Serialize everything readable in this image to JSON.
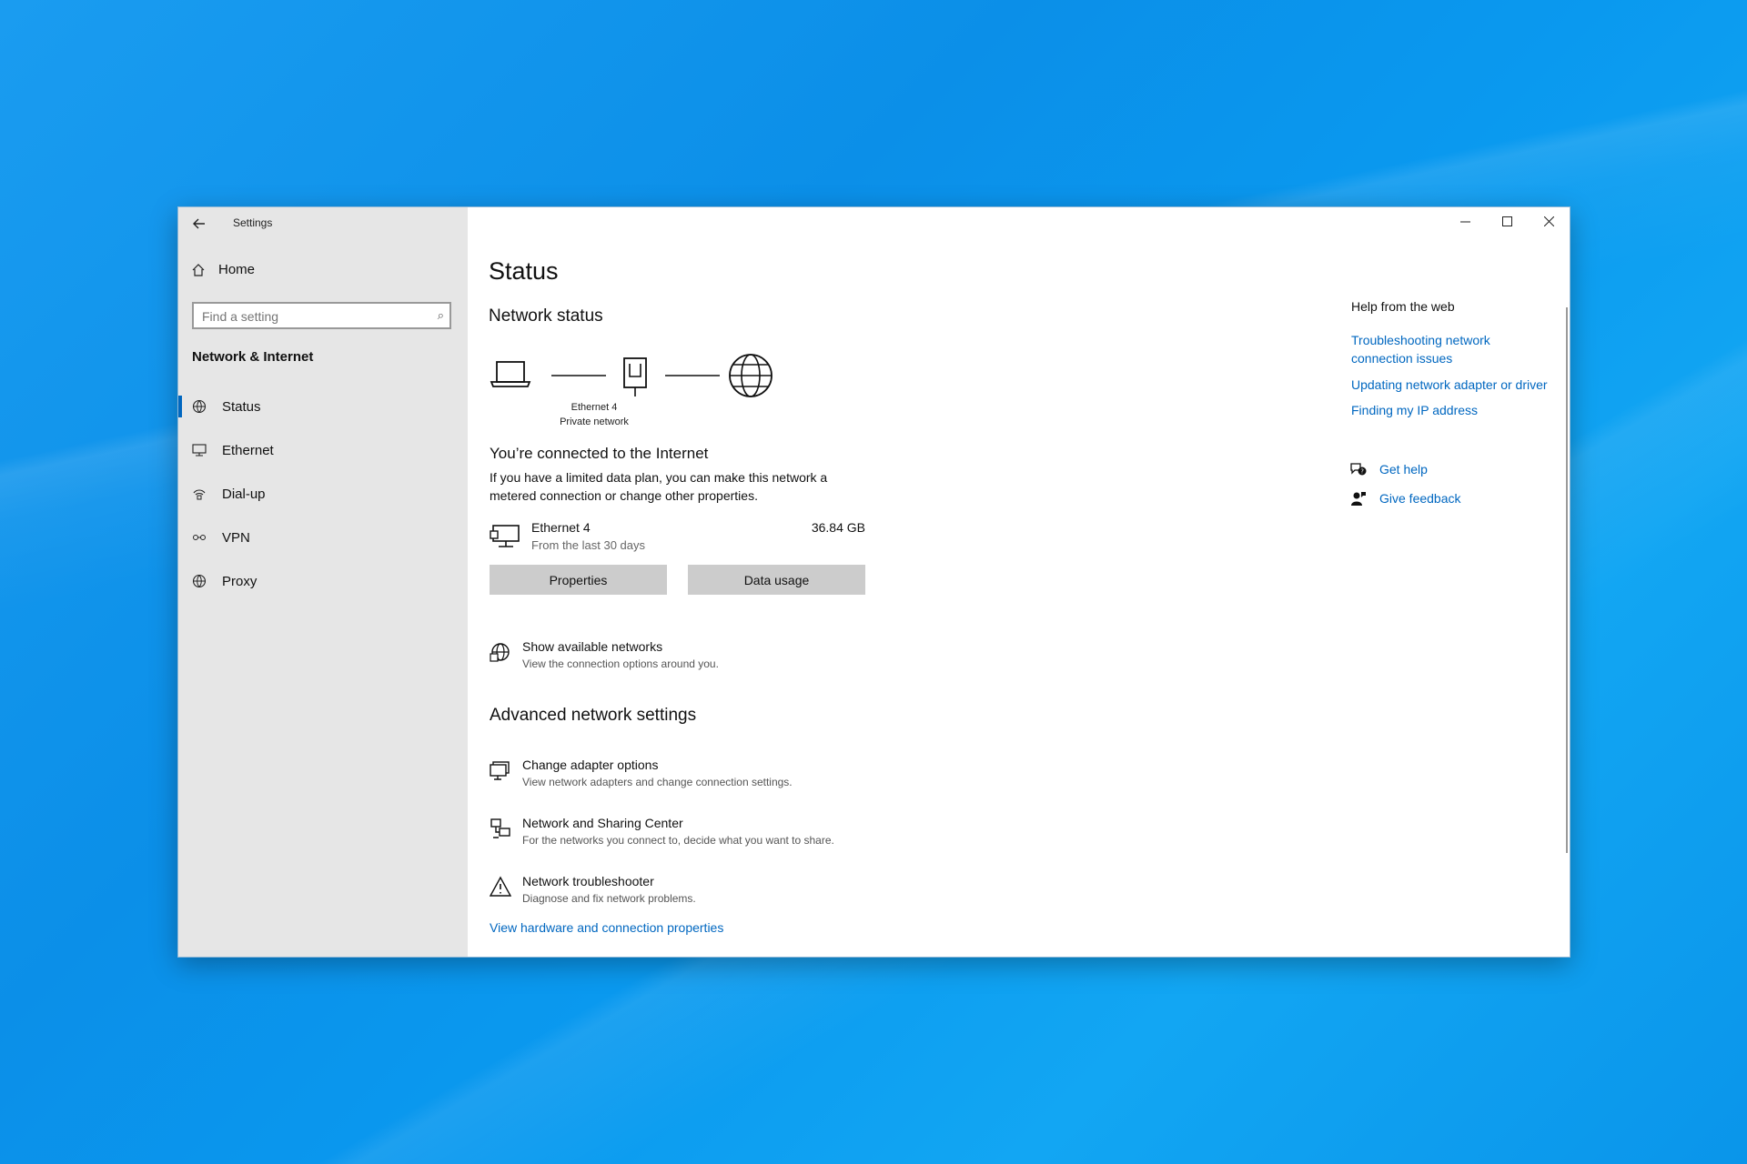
{
  "window": {
    "app_title": "Settings",
    "controls": {
      "minimize": "–",
      "maximize": "□",
      "close": "✕"
    }
  },
  "sidebar": {
    "home_label": "Home",
    "search_placeholder": "Find a setting",
    "section_title": "Network & Internet",
    "items": [
      {
        "label": "Status",
        "icon": "status-icon",
        "active": true
      },
      {
        "label": "Ethernet",
        "icon": "ethernet-icon",
        "active": false
      },
      {
        "label": "Dial-up",
        "icon": "dialup-icon",
        "active": false
      },
      {
        "label": "VPN",
        "icon": "vpn-icon",
        "active": false
      },
      {
        "label": "Proxy",
        "icon": "proxy-icon",
        "active": false
      }
    ]
  },
  "main": {
    "title": "Status",
    "network_status_heading": "Network status",
    "diagram": {
      "adapter_name": "Ethernet 4",
      "network_type": "Private network"
    },
    "connected_text": "You’re connected to the Internet",
    "description": "If you have a limited data plan, you can make this network a metered connection or change other properties.",
    "connection": {
      "name": "Ethernet 4",
      "sub": "From the last 30 days",
      "usage": "36.84 GB"
    },
    "buttons": {
      "properties": "Properties",
      "data_usage": "Data usage"
    },
    "show_networks": {
      "title": "Show available networks",
      "sub": "View the connection options around you."
    },
    "advanced_heading": "Advanced network settings",
    "advanced": [
      {
        "title": "Change adapter options",
        "sub": "View network adapters and change connection settings."
      },
      {
        "title": "Network and Sharing Center",
        "sub": "For the networks you connect to, decide what you want to share."
      },
      {
        "title": "Network troubleshooter",
        "sub": "Diagnose and fix network problems."
      }
    ],
    "hardware_link": "View hardware and connection properties"
  },
  "help": {
    "heading": "Help from the web",
    "links": [
      "Troubleshooting network connection issues",
      "Updating network adapter or driver",
      "Finding my IP address"
    ],
    "get_help": "Get help",
    "give_feedback": "Give feedback"
  },
  "colors": {
    "accent": "#0067c0",
    "sidebar_bg": "#e6e6e6",
    "desktop": "#0a95ea"
  }
}
